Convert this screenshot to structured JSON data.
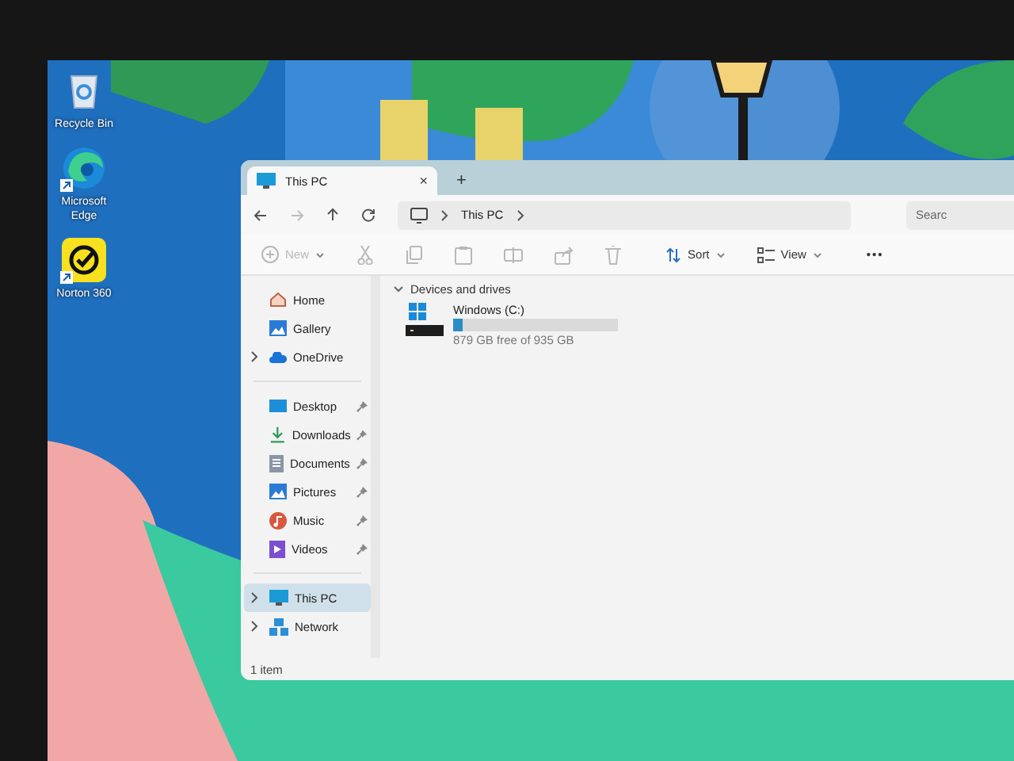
{
  "desktop_icons": [
    {
      "label": "Recycle Bin",
      "kind": "recycle",
      "shortcut": false
    },
    {
      "label": "Microsoft Edge",
      "kind": "edge",
      "shortcut": true
    },
    {
      "label": "Norton 360",
      "kind": "norton",
      "shortcut": true
    }
  ],
  "explorer": {
    "tab": {
      "title": "This PC",
      "close": "×"
    },
    "new_tab": "+",
    "breadcrumb": [
      "This PC"
    ],
    "search": {
      "placeholder": "Searc"
    },
    "toolbar": [
      {
        "kind": "new",
        "label": "New",
        "disabled": true
      },
      {
        "kind": "cut",
        "disabled": true
      },
      {
        "kind": "copy",
        "disabled": true
      },
      {
        "kind": "paste",
        "disabled": true
      },
      {
        "kind": "rename",
        "disabled": true
      },
      {
        "kind": "share",
        "disabled": true
      },
      {
        "kind": "delete",
        "disabled": true
      },
      {
        "kind": "sort",
        "label": "Sort",
        "disabled": false
      },
      {
        "kind": "view",
        "label": "View",
        "disabled": false
      },
      {
        "kind": "more",
        "label": "•••",
        "disabled": false
      }
    ],
    "sidebar": [
      [
        {
          "label": "Home",
          "kind": "home",
          "selected": false
        },
        {
          "label": "Gallery",
          "kind": "gallery",
          "selected": false
        },
        {
          "label": "OneDrive",
          "kind": "cloud",
          "selected": false,
          "expandable": true
        }
      ],
      [
        {
          "label": "Desktop",
          "kind": "desktop",
          "selected": false,
          "pinned": true
        },
        {
          "label": "Downloads",
          "kind": "downloads",
          "selected": false,
          "pinned": true
        },
        {
          "label": "Documents",
          "kind": "documents",
          "selected": false,
          "pinned": true
        },
        {
          "label": "Pictures",
          "kind": "pictures",
          "selected": false,
          "pinned": true
        },
        {
          "label": "Music",
          "kind": "music",
          "selected": false,
          "pinned": true
        },
        {
          "label": "Videos",
          "kind": "videos",
          "selected": false,
          "pinned": true
        }
      ],
      [
        {
          "label": "This PC",
          "kind": "pc",
          "selected": true,
          "expandable": true
        },
        {
          "label": "Network",
          "kind": "network",
          "selected": false,
          "expandable": true
        }
      ]
    ],
    "section": {
      "title": "Devices and drives",
      "expanded": true
    },
    "drives": [
      {
        "name": "Windows (C:)",
        "level": 0.06,
        "reading": "879 GB free of 935 GB"
      }
    ],
    "status_bar": "1 item"
  }
}
